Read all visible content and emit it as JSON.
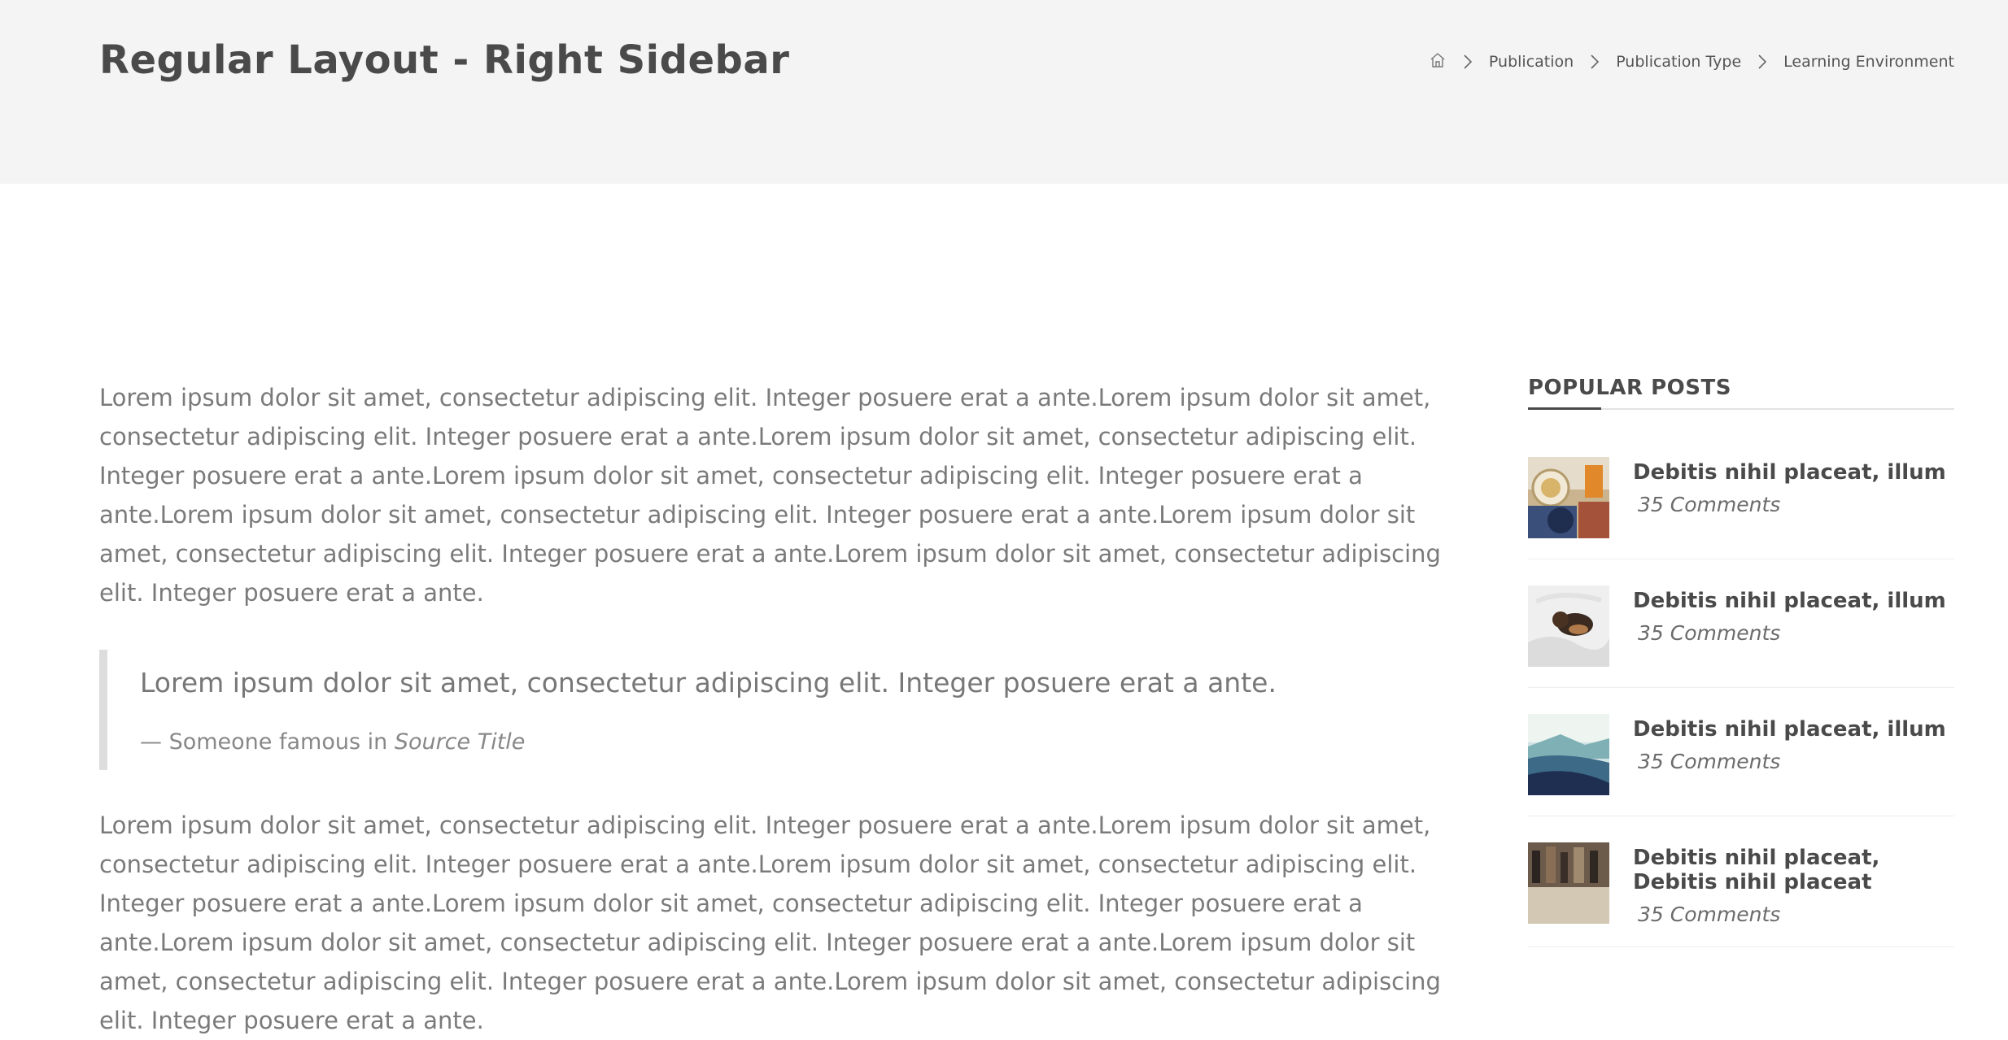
{
  "header": {
    "title": "Regular Layout - Right Sidebar",
    "breadcrumb": {
      "home_icon": "home-icon",
      "items": [
        "Publication",
        "Publication Type",
        "Learning Environment"
      ]
    }
  },
  "content": {
    "paragraph_1": "Lorem ipsum dolor sit amet, consectetur adipiscing elit. Integer posuere erat a ante.Lorem ipsum dolor sit amet, consectetur adipiscing elit. Integer posuere erat a ante.Lorem ipsum dolor sit amet, consectetur adipiscing elit. Integer posuere erat a ante.Lorem ipsum dolor sit amet, consectetur adipiscing elit. Integer posuere erat a ante.Lorem ipsum dolor sit amet, consectetur adipiscing elit. Integer posuere erat a ante.Lorem ipsum dolor sit amet, consectetur adipiscing elit. Integer posuere erat a ante.Lorem ipsum dolor sit amet, consectetur adipiscing elit. Integer posuere erat a ante.",
    "quote": {
      "text": "Lorem ipsum dolor sit amet, consectetur adipiscing elit. Integer posuere erat a ante.",
      "cite_prefix": "— Someone famous in ",
      "cite_source": "Source Title"
    },
    "paragraph_2": "Lorem ipsum dolor sit amet, consectetur adipiscing elit. Integer posuere erat a ante.Lorem ipsum dolor sit amet, consectetur adipiscing elit. Integer posuere erat a ante.Lorem ipsum dolor sit amet, consectetur adipiscing elit. Integer posuere erat a ante.Lorem ipsum dolor sit amet, consectetur adipiscing elit. Integer posuere erat a ante.Lorem ipsum dolor sit amet, consectetur adipiscing elit. Integer posuere erat a ante.Lorem ipsum dolor sit amet, consectetur adipiscing elit. Integer posuere erat a ante.Lorem ipsum dolor sit amet, consectetur adipiscing elit. Integer posuere erat a ante."
  },
  "sidebar": {
    "widget_title": "POPULAR POSTS",
    "posts": [
      {
        "title": "Debitis nihil placeat, illum",
        "comments": "35 Comments",
        "thumb": "drinks-table-photo"
      },
      {
        "title": "Debitis nihil placeat, illum",
        "comments": "35 Comments",
        "thumb": "dog-on-bed-photo"
      },
      {
        "title": "Debitis nihil placeat, illum",
        "comments": "35 Comments",
        "thumb": "mountain-sky-photo"
      },
      {
        "title": "Debitis nihil placeat, Debitis nihil placeat",
        "comments": "35 Comments",
        "thumb": "street-crowd-photo"
      }
    ]
  },
  "colors": {
    "header_bg": "#f4f4f4",
    "heading": "#4a4a4a",
    "body_text": "#7a7a7a",
    "quote_border": "#dddddd"
  }
}
